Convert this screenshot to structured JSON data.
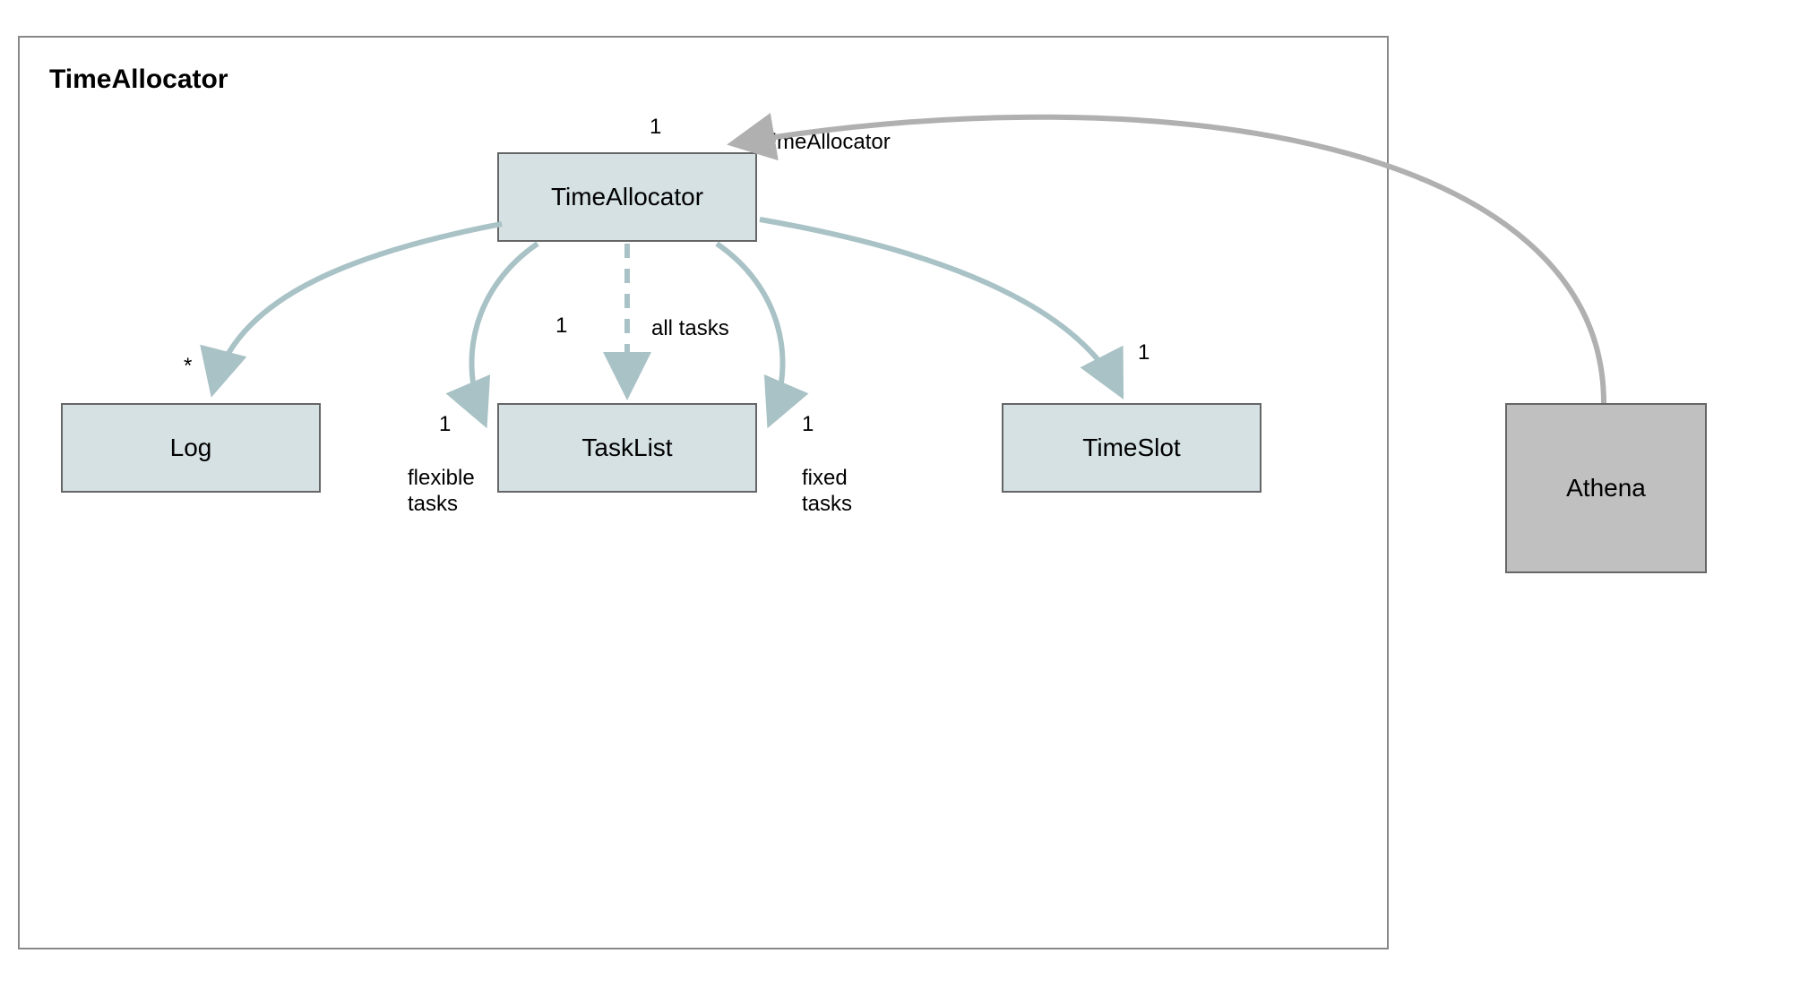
{
  "package": {
    "title": "TimeAllocator"
  },
  "classes": {
    "timeAllocator": "TimeAllocator",
    "log": "Log",
    "taskList": "TaskList",
    "timeSlot": "TimeSlot",
    "athena": "Athena"
  },
  "labels": {
    "athenaRole": "timeAllocator",
    "athenaMult": "1",
    "logMult": "*",
    "allTasksMult": "1",
    "allTasksRole": "all tasks",
    "flexibleMult": "1",
    "flexibleRole": "flexible\ntasks",
    "fixedMult": "1",
    "fixedRole": "fixed\ntasks",
    "timeSlotMult": "1"
  },
  "chart_data": {
    "type": "diagram",
    "diagram_type": "UML class/package diagram",
    "package": "TimeAllocator",
    "nodes": [
      {
        "id": "TimeAllocator",
        "in_package": true
      },
      {
        "id": "Log",
        "in_package": true
      },
      {
        "id": "TaskList",
        "in_package": true
      },
      {
        "id": "TimeSlot",
        "in_package": true
      },
      {
        "id": "Athena",
        "in_package": false
      }
    ],
    "edges": [
      {
        "from": "Athena",
        "to": "TimeAllocator",
        "role": "timeAllocator",
        "multiplicity": "1",
        "style": "solid"
      },
      {
        "from": "TimeAllocator",
        "to": "Log",
        "multiplicity": "*",
        "style": "solid"
      },
      {
        "from": "TimeAllocator",
        "to": "TaskList",
        "role": "all tasks",
        "multiplicity": "1",
        "style": "dashed"
      },
      {
        "from": "TimeAllocator",
        "to": "TaskList",
        "role": "flexible tasks",
        "multiplicity": "1",
        "style": "solid"
      },
      {
        "from": "TimeAllocator",
        "to": "TaskList",
        "role": "fixed tasks",
        "multiplicity": "1",
        "style": "solid"
      },
      {
        "from": "TimeAllocator",
        "to": "TimeSlot",
        "multiplicity": "1",
        "style": "solid"
      }
    ]
  }
}
